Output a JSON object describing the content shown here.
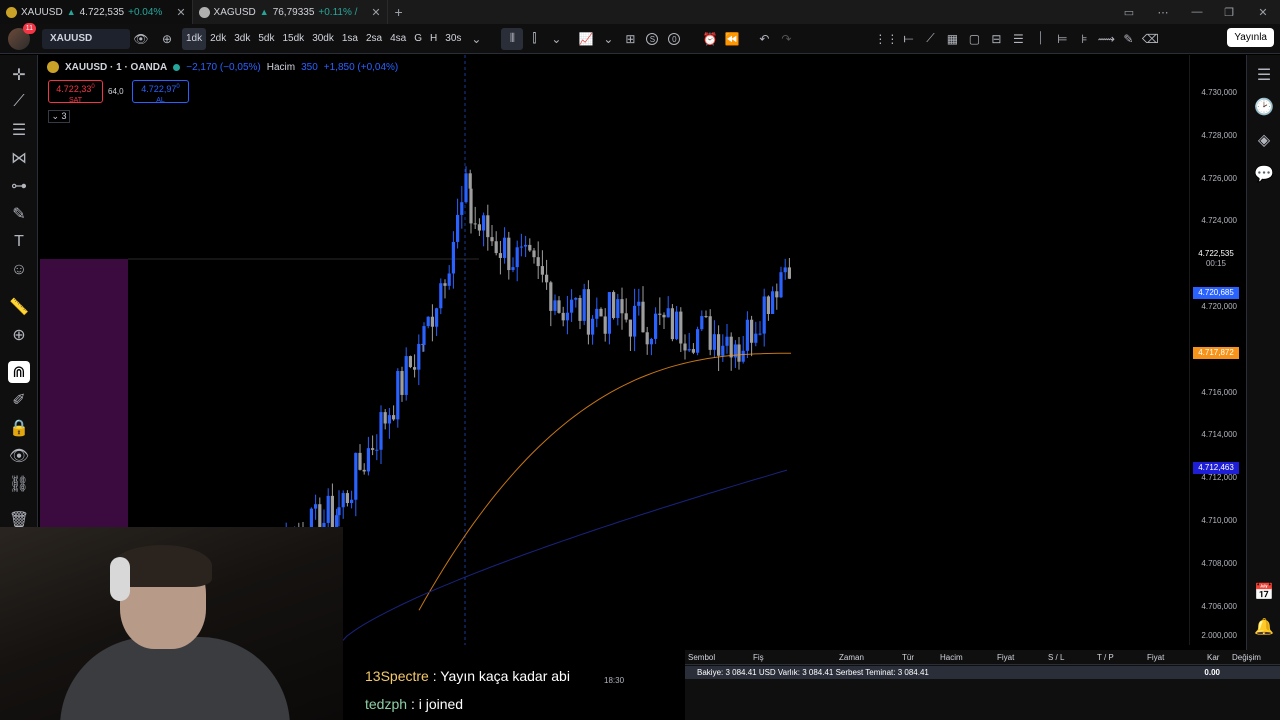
{
  "tabs": [
    {
      "symbol": "XAUUSD",
      "price": "4.722,535",
      "change": "+0.04%"
    },
    {
      "symbol": "XAGUSD",
      "price": "76,79335",
      "change": "+0.11% /"
    }
  ],
  "toolbar": {
    "symbol": "XAUUSD",
    "intervals": [
      "1dk",
      "2dk",
      "3dk",
      "5dk",
      "15dk",
      "30dk",
      "1sa",
      "2sa",
      "4sa",
      "G",
      "H",
      "30s"
    ],
    "selected_interval": "1dk",
    "notification_count": "11",
    "s_label": "S",
    "o_label": "0",
    "publish_label": "Yayınla"
  },
  "legend": {
    "title": "XAUUSD · 1 · OANDA",
    "change": "−2,170 (−0,05%)",
    "volume_label": "Hacim",
    "volume_value": "350",
    "volume_change": "+1,850 (+0,04%)"
  },
  "trade": {
    "sell_price": "4.722,33",
    "sell_sup": "0",
    "sell_label": "SAT",
    "spread": "64,0",
    "buy_price": "4.722,97",
    "buy_sup": "0",
    "buy_label": "AL",
    "collapse_label": "3"
  },
  "price_axis": {
    "ticks": [
      "4.730,000",
      "4.728,000",
      "4.726,000",
      "4.724,000",
      "4.720,000",
      "4.716,000",
      "4.714,000",
      "4.712,000",
      "4.710,000",
      "4.708,000",
      "4.706,000",
      "2.000,000"
    ],
    "current_price": "4.722,535",
    "countdown": "00:15",
    "label_blue1": "4.720,685",
    "label_orange": "4.717,872",
    "label_blue2": "4.712,463",
    "colors": {
      "up": "#2962ff",
      "down": "#9e9e9e",
      "ma_fast": "#f7931a",
      "ma_slow": "#1a237e"
    }
  },
  "time_label": "18:30",
  "chat": [
    {
      "user": "13Spectre",
      "message": "Yayın kaça kadar abi"
    },
    {
      "user": "tedzph",
      "message": "i joined"
    }
  ],
  "positions": {
    "columns": [
      "Sembol",
      "Fiş",
      "Zaman",
      "Tür",
      "Hacim",
      "Fiyat",
      "S / L",
      "T / P",
      "Fiyat",
      "Kar",
      "Değişim"
    ],
    "balance_line": "Bakiye: 3 084.41 USD  Varlık: 3 084.41  Serbest Teminat: 3 084.41",
    "balance_value": "0.00"
  }
}
